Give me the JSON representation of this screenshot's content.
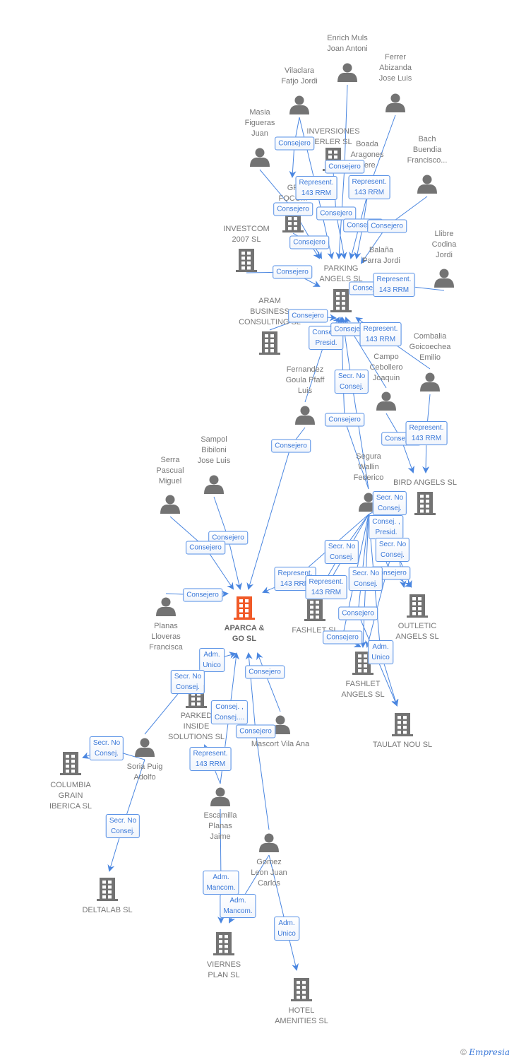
{
  "colors": {
    "edge": "#4a86e0",
    "node": "#737373",
    "main_node": "#f05a28",
    "label_text": "#3a78d8"
  },
  "nodes": [
    {
      "id": "p1",
      "type": "person",
      "name_lines": [
        "Enrich Muls",
        "Joan Antoni"
      ]
    },
    {
      "id": "p2",
      "type": "person",
      "name_lines": [
        "Ferrer",
        "Abizanda",
        "Jose Luis"
      ]
    },
    {
      "id": "p3",
      "type": "person",
      "name_lines": [
        "Vilaclara",
        "Fatjo Jordi"
      ]
    },
    {
      "id": "p4",
      "type": "person",
      "name_lines": [
        "Masia",
        "Figueras",
        "Juan"
      ]
    },
    {
      "id": "p5",
      "type": "person",
      "name_lines": [
        "Boada",
        "Aragones",
        "Pere"
      ]
    },
    {
      "id": "p6",
      "type": "person",
      "name_lines": [
        "Bach",
        "Buendia",
        "Francisco..."
      ]
    },
    {
      "id": "p7",
      "type": "person",
      "name_lines": [
        "Llibre",
        "Codina",
        "Jordi"
      ]
    },
    {
      "id": "p8",
      "type": "person",
      "name_lines": [
        "Balaña",
        "Parra Jordi"
      ]
    },
    {
      "id": "p9",
      "type": "person",
      "name_lines": [
        "Combalia",
        "Goicoechea",
        "Emilio"
      ]
    },
    {
      "id": "p10",
      "type": "person",
      "name_lines": [
        "Campo",
        "Cebollero",
        "Joaquin"
      ]
    },
    {
      "id": "p11",
      "type": "person",
      "name_lines": [
        "Fernandez",
        "Goula Pfaff",
        "Luis"
      ]
    },
    {
      "id": "p12",
      "type": "person",
      "name_lines": [
        "Segura",
        "Wallin",
        "Federico"
      ]
    },
    {
      "id": "p13",
      "type": "person",
      "name_lines": [
        "Sampol",
        "Bibiloni",
        "Jose Luis"
      ]
    },
    {
      "id": "p14",
      "type": "person",
      "name_lines": [
        "Serra",
        "Pascual",
        "Miguel"
      ]
    },
    {
      "id": "p15",
      "type": "person",
      "name_lines": [
        "Planas",
        "Lloveras",
        "Francisca"
      ]
    },
    {
      "id": "p16",
      "type": "person",
      "name_lines": [
        "Mascort Vila Ana"
      ]
    },
    {
      "id": "p17",
      "type": "person",
      "name_lines": [
        "Soria Puig",
        "Adolfo"
      ]
    },
    {
      "id": "p18",
      "type": "person",
      "name_lines": [
        "Escamilla",
        "Planas",
        "Jaime"
      ]
    },
    {
      "id": "p19",
      "type": "person",
      "name_lines": [
        "Gomez",
        "Leon Juan",
        "Carlos"
      ]
    },
    {
      "id": "c1",
      "type": "company",
      "name_lines": [
        "INVERSIONES",
        "ERLER  SL"
      ]
    },
    {
      "id": "c2",
      "type": "company",
      "name_lines": [
        "GR",
        "FOCOM"
      ]
    },
    {
      "id": "c3",
      "type": "company",
      "name_lines": [
        "INVESTCOM",
        "2007 SL"
      ]
    },
    {
      "id": "c4",
      "type": "company",
      "name_lines": [
        "PARKING",
        "ANGELS SL"
      ]
    },
    {
      "id": "c5",
      "type": "company",
      "name_lines": [
        "ARAM",
        "BUSINESS",
        "CONSULTING SL"
      ]
    },
    {
      "id": "c6",
      "type": "company",
      "name_lines": [
        "BIRD ANGELS SL"
      ]
    },
    {
      "id": "c7",
      "type": "company",
      "main": true,
      "name_lines": [
        "APARCA &",
        "GO  SL"
      ]
    },
    {
      "id": "c8",
      "type": "company",
      "name_lines": [
        "FASHLET SL"
      ]
    },
    {
      "id": "c9",
      "type": "company",
      "name_lines": [
        "OUTLETIC",
        "ANGELS SL"
      ]
    },
    {
      "id": "c10",
      "type": "company",
      "name_lines": [
        "FASHLET",
        "ANGELS SL"
      ]
    },
    {
      "id": "c11",
      "type": "company",
      "name_lines": [
        "TAULAT NOU SL"
      ]
    },
    {
      "id": "c12",
      "type": "company",
      "name_lines": [
        "PARKED",
        "INSIDE",
        "SOLUTIONS SL"
      ]
    },
    {
      "id": "c13",
      "type": "company",
      "name_lines": [
        "COLUMBIA",
        "GRAIN",
        "IBERICA SL"
      ]
    },
    {
      "id": "c14",
      "type": "company",
      "name_lines": [
        "DELTALAB  SL"
      ]
    },
    {
      "id": "c15",
      "type": "company",
      "name_lines": [
        "VIERNES",
        "PLAN SL"
      ]
    },
    {
      "id": "c16",
      "type": "company",
      "name_lines": [
        "HOTEL",
        "AMENITIES SL"
      ]
    }
  ],
  "edges": [
    {
      "from": "p3",
      "to": "c2",
      "role": [
        "Consejero"
      ]
    },
    {
      "from": "p1",
      "to": "c4",
      "role": [
        "Consejero"
      ]
    },
    {
      "from": "p3",
      "to": "c4",
      "role": [
        "Represent.",
        "143 RRM"
      ]
    },
    {
      "from": "p2",
      "to": "c4",
      "role": [
        "Represent.",
        "143 RRM"
      ]
    },
    {
      "from": "p4",
      "to": "c4",
      "role": [
        "Consejero"
      ]
    },
    {
      "from": "c1",
      "to": "c4",
      "role": [
        "Consejero"
      ]
    },
    {
      "from": "p5",
      "to": "c4",
      "role": [
        "Consejero"
      ]
    },
    {
      "from": "p6",
      "to": "c4",
      "role": [
        "Consejero"
      ]
    },
    {
      "from": "c2",
      "to": "c4",
      "role": [
        "Consejero"
      ]
    },
    {
      "from": "c3",
      "to": "c4",
      "role": [
        "Consejero"
      ]
    },
    {
      "from": "p8",
      "to": "c4",
      "role": [
        "Consejero"
      ]
    },
    {
      "from": "p7",
      "to": "c4",
      "role": [
        "Represent.",
        "143 RRM"
      ]
    },
    {
      "from": "c5",
      "to": "c4",
      "role": [
        "Consejero"
      ]
    },
    {
      "from": "p11",
      "to": "c4",
      "role": [
        "Consej. ,",
        "Presid."
      ]
    },
    {
      "from": "p10",
      "to": "c4",
      "role": [
        "Consejero"
      ]
    },
    {
      "from": "p9",
      "to": "c4",
      "role": [
        "Represent.",
        "143 RRM"
      ]
    },
    {
      "from": "p12",
      "to": "c4",
      "role": [
        "Secr.  No",
        "Consej."
      ]
    },
    {
      "from": "p12",
      "to": "c4",
      "role": [
        "Consejero"
      ]
    },
    {
      "from": "p11",
      "to": "c7",
      "role": [
        "Consejero"
      ]
    },
    {
      "from": "p10",
      "to": "c6",
      "role": [
        "Consejero"
      ]
    },
    {
      "from": "p9",
      "to": "c6",
      "role": [
        "Represent.",
        "143 RRM"
      ]
    },
    {
      "from": "p12",
      "to": "c9",
      "role": [
        "Secr.  No",
        "Consej."
      ]
    },
    {
      "from": "p12",
      "to": "c9",
      "role": [
        "Consej. ,",
        "Presid."
      ]
    },
    {
      "from": "p12",
      "to": "c10",
      "role": [
        "Secr.  No",
        "Consej."
      ]
    },
    {
      "from": "p12",
      "to": "c9",
      "role": [
        "Consejero"
      ]
    },
    {
      "from": "p12",
      "to": "c8",
      "role": [
        "Secr.  No",
        "Consej."
      ]
    },
    {
      "from": "p12",
      "to": "c7",
      "role": [
        "Represent.",
        "143 RRM"
      ]
    },
    {
      "from": "p12",
      "to": "c8",
      "role": [
        "Represent.",
        "143 RRM"
      ]
    },
    {
      "from": "p12",
      "to": "c10",
      "role": [
        "Secr.  No",
        "Consej."
      ]
    },
    {
      "from": "p12",
      "to": "c11",
      "role": [
        "Consejero"
      ]
    },
    {
      "from": "p12",
      "to": "c10",
      "role": [
        "Consejero"
      ]
    },
    {
      "from": "p12",
      "to": "c11",
      "role": [
        "Adm.",
        "Unico"
      ]
    },
    {
      "from": "p13",
      "to": "c7",
      "role": [
        "Consejero"
      ]
    },
    {
      "from": "p14",
      "to": "c7",
      "role": [
        "Consejero"
      ]
    },
    {
      "from": "p15",
      "to": "c7",
      "role": [
        "Consejero"
      ]
    },
    {
      "from": "c12",
      "to": "c7",
      "role": [
        "Adm.",
        "Unico"
      ]
    },
    {
      "from": "p17",
      "to": "c7",
      "role": [
        "Secr.  No",
        "Consej."
      ]
    },
    {
      "from": "p16",
      "to": "c7",
      "role": [
        "Consejero"
      ]
    },
    {
      "from": "p18",
      "to": "c7",
      "role": [
        "Consej. ,",
        "Consej...."
      ]
    },
    {
      "from": "p19",
      "to": "c7",
      "role": [
        "Consejero"
      ]
    },
    {
      "from": "p18",
      "to": "c12",
      "role": [
        "Represent.",
        "143 RRM"
      ]
    },
    {
      "from": "p17",
      "to": "c13",
      "role": [
        "Secr.  No",
        "Consej."
      ]
    },
    {
      "from": "p17",
      "to": "c14",
      "role": [
        "Secr.  No",
        "Consej."
      ]
    },
    {
      "from": "p18",
      "to": "c15",
      "role": [
        "Adm.",
        "Mancom."
      ]
    },
    {
      "from": "p19",
      "to": "c15",
      "role": [
        "Adm.",
        "Mancom."
      ]
    },
    {
      "from": "p19",
      "to": "c16",
      "role": [
        "Adm.",
        "Unico"
      ]
    }
  ],
  "footer": {
    "copyright": "©",
    "brand": "Empresia"
  }
}
